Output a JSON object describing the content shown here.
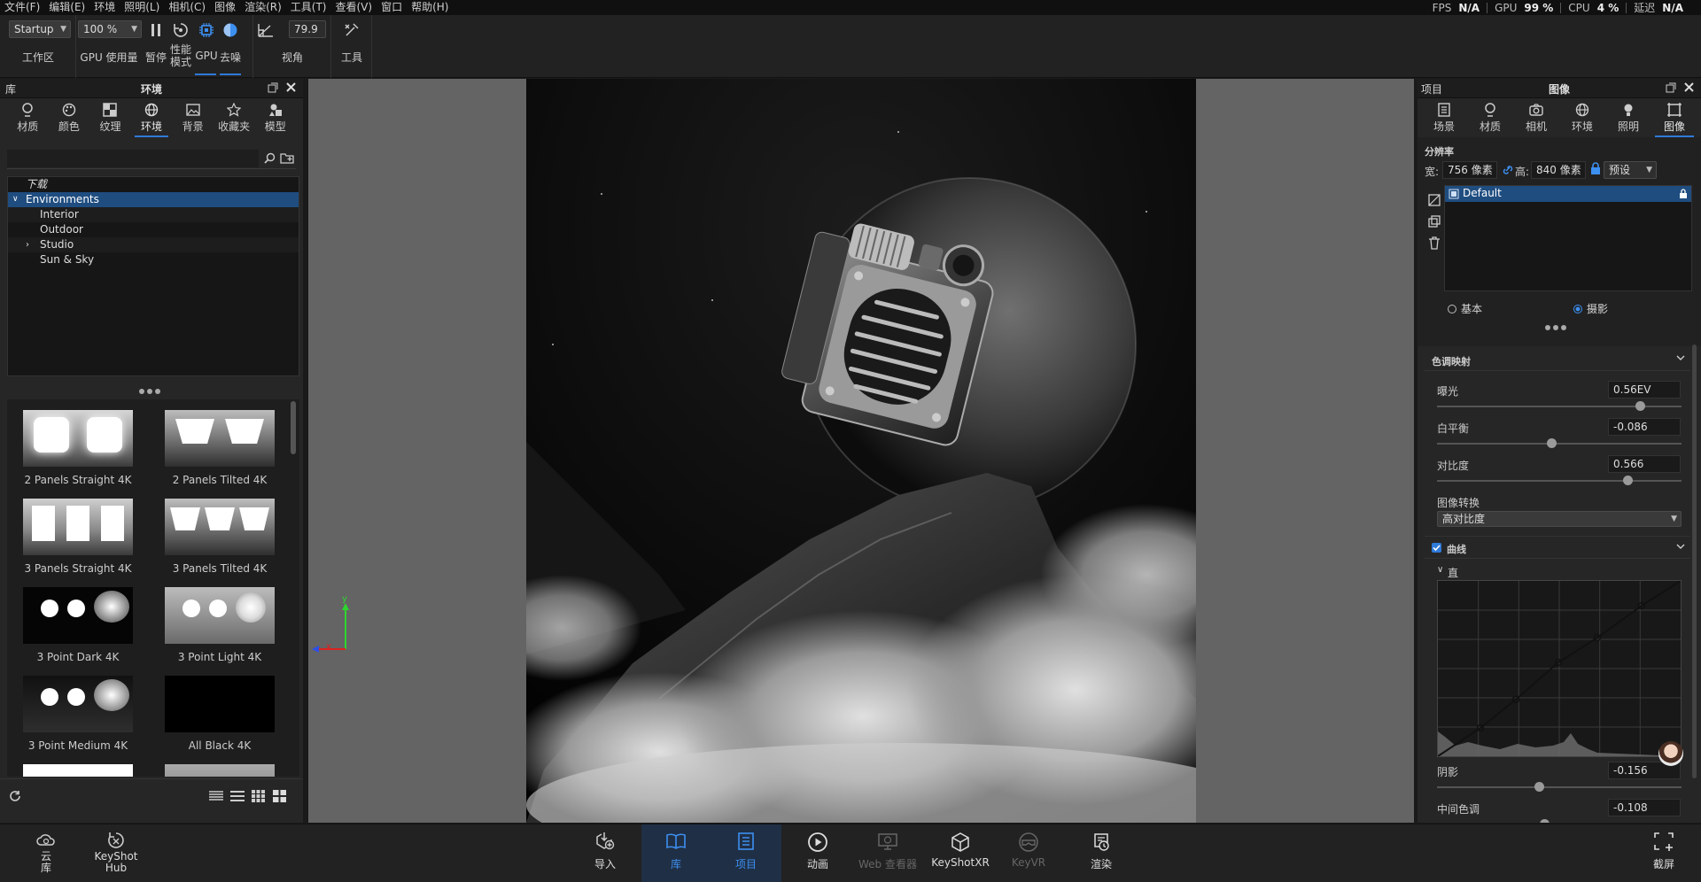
{
  "menubar": {
    "items": [
      "文件(F)",
      "编辑(E)",
      "环境",
      "照明(L)",
      "相机(C)",
      "图像",
      "渲染(R)",
      "工具(T)",
      "查看(V)",
      "窗口",
      "帮助(H)"
    ],
    "fps_label": "FPS",
    "fps_value": "N/A",
    "gpu_label": "GPU",
    "gpu_value": "99 %",
    "cpu_label": "CPU",
    "cpu_value": "4 %",
    "latency_label": "延迟",
    "latency_value": "N/A"
  },
  "toolbar": {
    "workspace_value": "Startup",
    "workspace_label": "工作区",
    "zoom_value": "100 %",
    "gpu_usage_label": "GPU 使用量",
    "pause_label": "暂停",
    "perf_label_1": "性能",
    "perf_label_2": "模式",
    "gpu_label": "GPU",
    "denoise_label": "去噪",
    "fov_value": "79.9",
    "fov_label": "视角",
    "tools_label": "工具"
  },
  "left_panel": {
    "header_lib": "库",
    "header_title": "环境",
    "tabs": [
      {
        "label": "材质",
        "icon": "material-icon"
      },
      {
        "label": "颜色",
        "icon": "palette-icon"
      },
      {
        "label": "纹理",
        "icon": "texture-icon"
      },
      {
        "label": "环境",
        "icon": "globe-icon"
      },
      {
        "label": "背景",
        "icon": "image-icon"
      },
      {
        "label": "收藏夹",
        "icon": "star-icon"
      },
      {
        "label": "模型",
        "icon": "models-icon"
      }
    ],
    "tree": {
      "downloads": "下载",
      "root": "Environments",
      "children": [
        "Interior",
        "Outdoor",
        "Studio",
        "Sun & Sky"
      ]
    },
    "thumbnails": [
      {
        "caption": "2 Panels Straight 4K"
      },
      {
        "caption": "2 Panels Tilted 4K"
      },
      {
        "caption": "3 Panels Straight 4K"
      },
      {
        "caption": "3 Panels Tilted 4K"
      },
      {
        "caption": "3 Point Dark 4K"
      },
      {
        "caption": "3 Point Light 4K"
      },
      {
        "caption": "3 Point Medium 4K"
      },
      {
        "caption": "All Black 4K"
      }
    ]
  },
  "viewport": {
    "axis_y": "y",
    "axis_x": "x"
  },
  "right_panel": {
    "header_project": "项目",
    "header_title": "图像",
    "tabs": [
      {
        "label": "场景",
        "icon": "scene-icon"
      },
      {
        "label": "材质",
        "icon": "material-icon"
      },
      {
        "label": "相机",
        "icon": "camera-icon"
      },
      {
        "label": "环境",
        "icon": "globe-icon"
      },
      {
        "label": "照明",
        "icon": "bulb-icon"
      },
      {
        "label": "图像",
        "icon": "image-frame-icon"
      }
    ],
    "resolution_label": "分辨率",
    "width_label": "宽:",
    "width_value": "756 像素",
    "height_label": "高:",
    "height_value": "840 像素",
    "preset_value": "预设",
    "image_style": "Default",
    "mode_basic": "基本",
    "mode_photo": "摄影",
    "tone_mapping_label": "色调映射",
    "exposure_label": "曝光",
    "exposure_value": "0.56EV",
    "exposure_pos": 0.83,
    "wb_label": "白平衡",
    "wb_value": "-0.086",
    "wb_pos": 0.47,
    "contrast_label": "对比度",
    "contrast_value": "0.566",
    "contrast_pos": 0.78,
    "transform_label": "图像转换",
    "transform_value": "高对比度",
    "curve_label": "曲线",
    "histogram_label": "直方图",
    "shadows_label": "阴影",
    "shadows_value": "-0.156",
    "shadows_pos": 0.42,
    "midtones_label": "中间色调",
    "midtones_value": "-0.108",
    "midtones_pos": 0.44
  },
  "bottombar": {
    "cloud_label_1": "云",
    "cloud_label_2": "库",
    "hub_label_1": "KeyShot",
    "hub_label_2": "Hub",
    "items": [
      {
        "label": "导入",
        "icon": "import-icon",
        "state": "normal"
      },
      {
        "label": "库",
        "icon": "library-icon",
        "state": "active"
      },
      {
        "label": "项目",
        "icon": "project-icon",
        "state": "active"
      },
      {
        "label": "动画",
        "icon": "play-icon",
        "state": "normal"
      },
      {
        "label": "Web 查看器",
        "icon": "web-viewer-icon",
        "state": "disabled"
      },
      {
        "label": "KeyShotXR",
        "icon": "cube-icon",
        "state": "normal"
      },
      {
        "label": "KeyVR",
        "icon": "vr-icon",
        "state": "disabled"
      },
      {
        "label": "渲染",
        "icon": "render-icon",
        "state": "normal"
      }
    ],
    "screenshot_label": "截屏"
  }
}
